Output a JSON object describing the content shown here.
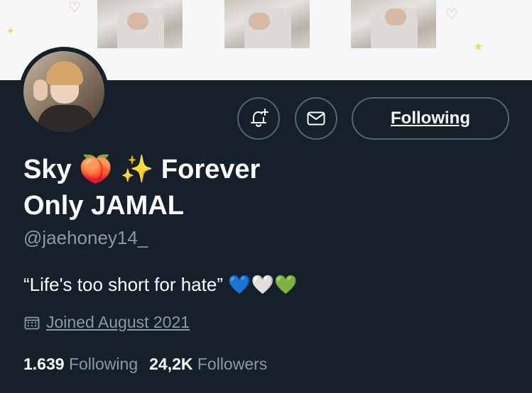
{
  "profile": {
    "display_name_line1": "Sky 🍑 ✨ Forever",
    "display_name_line2": "Only JAMAL",
    "handle": "@jaehoney14_",
    "bio": "“Life's too short for hate” 💙🤍💚",
    "joined": "Joined August 2021"
  },
  "actions": {
    "follow_label": "Following"
  },
  "stats": {
    "following_count": "1.639",
    "following_label": "Following",
    "followers_count": "24,2K",
    "followers_label": "Followers"
  },
  "icons": {
    "notifications": "bell-plus-icon",
    "message": "envelope-icon",
    "calendar": "calendar-icon"
  },
  "colors": {
    "background": "#15202b",
    "text": "#ffffff",
    "muted": "#8b98a5",
    "border": "#536471"
  }
}
